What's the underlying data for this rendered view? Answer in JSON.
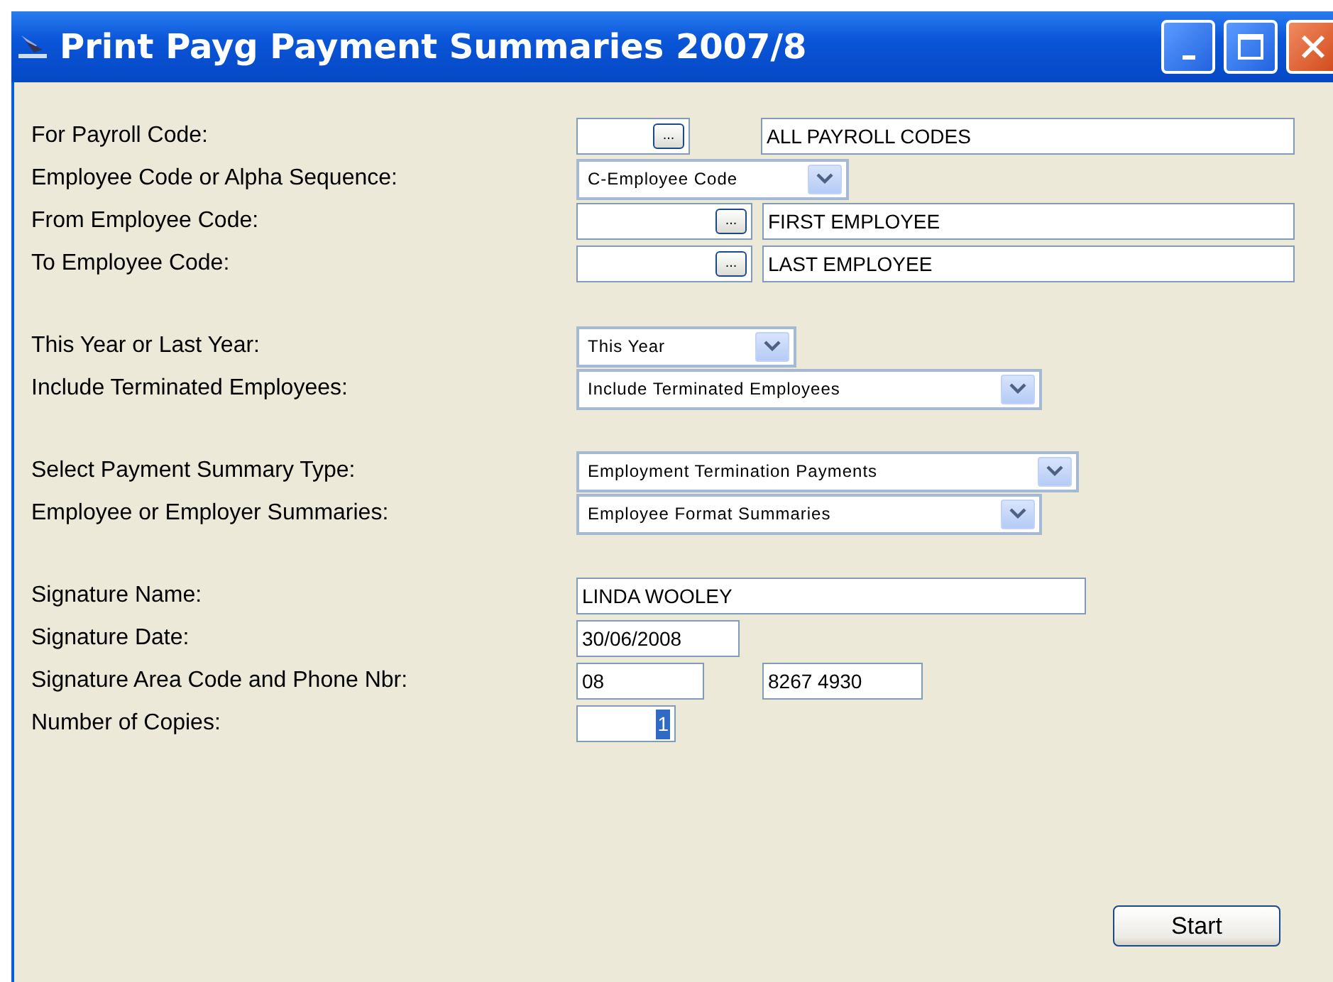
{
  "window": {
    "title": "Print Payg Payment Summaries 2007/8"
  },
  "sections": [
    {
      "rows": [
        {
          "label": "For Payroll Code:",
          "controls": [
            {
              "kind": "lookup",
              "button_label": "..."
            },
            {
              "kind": "text",
              "value": "ALL PAYROLL CODES"
            }
          ]
        },
        {
          "label": "Employee Code or Alpha Sequence:",
          "controls": [
            {
              "kind": "select",
              "value": "C-Employee Code"
            }
          ]
        },
        {
          "label": "From Employee Code:",
          "controls": [
            {
              "kind": "lookup",
              "button_label": "..."
            },
            {
              "kind": "text",
              "value": "FIRST EMPLOYEE"
            }
          ]
        },
        {
          "label": "To Employee Code:",
          "controls": [
            {
              "kind": "lookup",
              "button_label": "..."
            },
            {
              "kind": "text",
              "value": "LAST EMPLOYEE"
            }
          ]
        }
      ]
    },
    {
      "rows": [
        {
          "label": "This Year or Last Year:",
          "controls": [
            {
              "kind": "select",
              "value": "This Year"
            }
          ]
        },
        {
          "label": "Include Terminated Employees:",
          "controls": [
            {
              "kind": "select",
              "value": "Include Terminated Employees"
            }
          ]
        }
      ]
    },
    {
      "rows": [
        {
          "label": "Select Payment Summary Type:",
          "controls": [
            {
              "kind": "select",
              "value": "Employment Termination Payments"
            }
          ]
        },
        {
          "label": "Employee or Employer Summaries:",
          "controls": [
            {
              "kind": "select",
              "value": "Employee Format Summaries"
            }
          ]
        }
      ]
    },
    {
      "rows": [
        {
          "label": "Signature Name:",
          "controls": [
            {
              "kind": "text",
              "value": "LINDA WOOLEY"
            }
          ]
        },
        {
          "label": "Signature Date:",
          "controls": [
            {
              "kind": "text",
              "value": "30/06/2008"
            }
          ]
        },
        {
          "label": "Signature Area Code and Phone Nbr:",
          "controls": [
            {
              "kind": "text",
              "value": "08"
            },
            {
              "kind": "text",
              "value": "8267 4930"
            }
          ]
        },
        {
          "label": "Number of Copies:",
          "controls": [
            {
              "kind": "number",
              "value": "1",
              "highlighted": true
            }
          ]
        }
      ]
    }
  ],
  "buttons": [
    {
      "label": "Start"
    }
  ]
}
